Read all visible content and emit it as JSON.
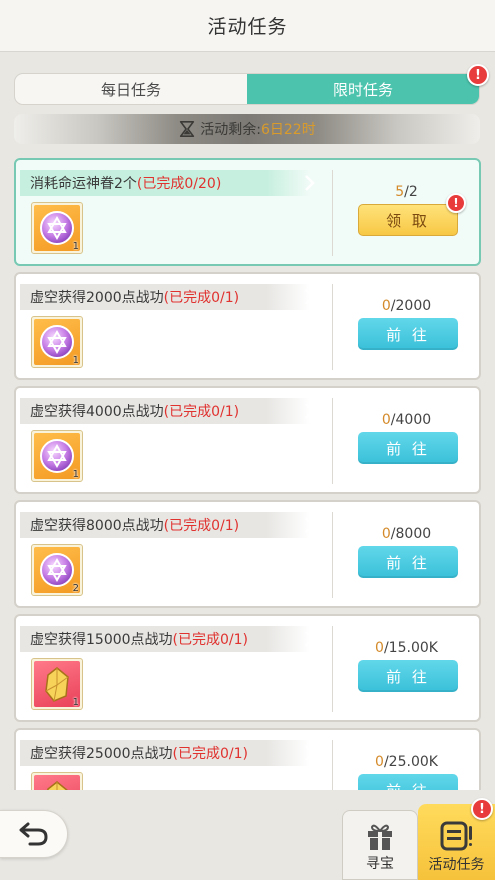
{
  "header": {
    "title": "活动任务"
  },
  "tabs": [
    {
      "label": "每日任务",
      "active": false
    },
    {
      "label": "限时任务",
      "active": true
    }
  ],
  "alert_glyph": "!",
  "timer": {
    "label": "活动剩余:",
    "value": "6日22时",
    "icon": "hourglass-icon"
  },
  "tasks": [
    {
      "title": "消耗命运神眷2个",
      "status": "(已完成0/20)",
      "item_qty": "1",
      "item_icon": "star-of-david-orb-icon",
      "progress_current": "5",
      "progress_total": "/2",
      "button": "领 取",
      "button_type": "claim",
      "has_alert": true
    },
    {
      "title": "虚空获得2000点战功",
      "status": "(已完成0/1)",
      "item_qty": "1",
      "item_icon": "star-of-david-orb-icon",
      "progress_current": "0",
      "progress_total": "/2000",
      "button": "前 往",
      "button_type": "go",
      "has_alert": false
    },
    {
      "title": "虚空获得4000点战功",
      "status": "(已完成0/1)",
      "item_qty": "1",
      "item_icon": "star-of-david-orb-icon",
      "progress_current": "0",
      "progress_total": "/4000",
      "button": "前 往",
      "button_type": "go",
      "has_alert": false
    },
    {
      "title": "虚空获得8000点战功",
      "status": "(已完成0/1)",
      "item_qty": "2",
      "item_icon": "star-of-david-orb-icon",
      "progress_current": "0",
      "progress_total": "/8000",
      "button": "前 往",
      "button_type": "go",
      "has_alert": false
    },
    {
      "title": "虚空获得15000点战功",
      "status": "(已完成0/1)",
      "item_qty": "1",
      "item_icon": "yellow-crystal-icon",
      "progress_current": "0",
      "progress_total": "/15.00K",
      "button": "前 往",
      "button_type": "go",
      "has_alert": false
    },
    {
      "title": "虚空获得25000点战功",
      "status": "(已完成0/1)",
      "item_qty": "1",
      "item_icon": "crystal-icon",
      "progress_current": "0",
      "progress_total": "/25.00K",
      "button": "前 往",
      "button_type": "go",
      "has_alert": false
    }
  ],
  "bottom_nav": {
    "back_icon": "back-arrow-icon",
    "treasure_label": "寻宝",
    "treasure_icon": "gift-icon",
    "activity_label": "活动任务",
    "activity_icon": "task-list-icon"
  },
  "colors": {
    "accent": "#4cc3ad",
    "go_button": "#39c0d9",
    "claim_button": "#f7c845",
    "alert": "#e83b3b",
    "status_red": "#e0322f",
    "progress_orange": "#d48a2a"
  }
}
